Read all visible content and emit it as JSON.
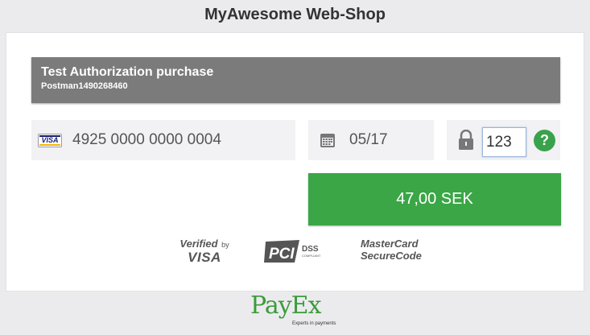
{
  "shop": {
    "title": "MyAwesome Web-Shop"
  },
  "header": {
    "title": "Test Authorization purchase",
    "subtitle": "Postman1490268460"
  },
  "card": {
    "brand_label": "VISA",
    "number": "4925 0000 0000 0004",
    "icon": "visa-card-icon"
  },
  "expiry": {
    "value": "05/17",
    "icon": "calendar-icon"
  },
  "cvc": {
    "value": "123",
    "icon": "lock-icon",
    "help_label": "?"
  },
  "pay_button": {
    "label": "47,00 SEK"
  },
  "security_logos": {
    "verified_by_visa": {
      "line1": "Verified",
      "line2": "by",
      "line3": "VISA"
    },
    "pci_dss": {
      "main": "PCI",
      "dss": "DSS",
      "compliant": "COMPLIANT"
    },
    "mastercard": {
      "line1": "MasterCard",
      "line2": "SecureCode"
    }
  },
  "footer": {
    "brand": "PayEx",
    "tagline": "Experts in payments"
  },
  "colors": {
    "accent_green": "#3aa646",
    "header_gray": "#7b7b7b",
    "background": "#ebebee"
  }
}
